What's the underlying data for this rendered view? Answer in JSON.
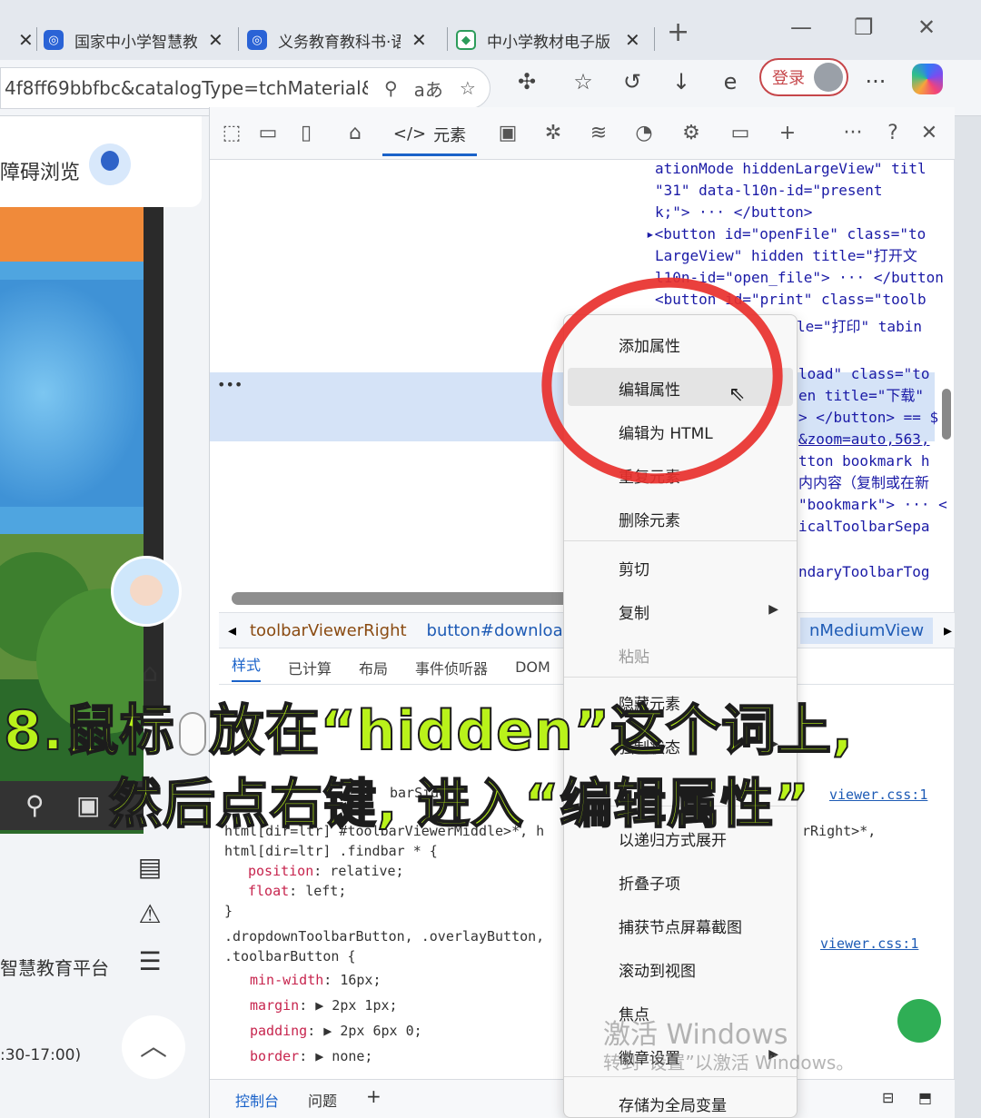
{
  "tabs": [
    {
      "title": "国家中小学智慧教",
      "close": "✕"
    },
    {
      "title": "义务教育教科书·语",
      "close": "✕"
    },
    {
      "title": "中小学教材电子版",
      "close": "✕"
    }
  ],
  "first_tab_close": "✕",
  "new_tab": "+",
  "address": {
    "url": "4f8ff69bbfbc&catalogType=tchMaterial&..."
  },
  "login_label": "登录",
  "page": {
    "accessibility_label": "障碍浏览",
    "platform_label": "智慧教育平台",
    "time_label": ":30-17:00)"
  },
  "devtools": {
    "elements_tab": "元素",
    "code_lines": [
      "ationMode hiddenLargeView\" titl",
      "\"31\" data-l10n-id=\"present",
      "k;\"> ··· </button>",
      "▸<button id=\"openFile\" class=\"to",
      "LargeView\" hidden title=\"打开文",
      "l10n-id=\"open_file\"> ··· </button",
      "<button id=\"print\" class=\"toolb",
      "le=\"打印\" tabin"
    ],
    "right_lines": [
      "load\" class=\"to",
      "en title=\"下载\"",
      "> </button> == $",
      "&zoom=auto,563,",
      "tton bookmark h",
      "内内容（复制或在新",
      "\"bookmark\"> ··· <",
      "icalToolbarSepa",
      "ndaryToolbarTog"
    ],
    "ellipsis": "•••",
    "breadcrumbs": {
      "c1": "toolbarViewerRight",
      "c2": "button#download.t",
      "c3": "nMediumView"
    },
    "subtabs": [
      "样式",
      "已计算",
      "布局",
      "事件侦听器",
      "DOM"
    ],
    "css_lines": [
      "html[dir=ltr] #toolbarViewerMiddle>*, h",
      "html[dir=ltr] .findbar * {",
      "position: relative;",
      "float: left;",
      "}",
      ".dropdownToolbarButton, .overlayButton,",
      ".toolbarButton {",
      "min-width: 16px;",
      "margin: ▶ 2px 1px;",
      "padding: ▶ 2px 6px 0;",
      "border: ▶ none;"
    ],
    "css_partials": {
      "sidebar": "barSide",
      "rightpart": "rRight>*,",
      "viewer1": "viewer.css:1",
      "viewer2": "viewer.css:1"
    },
    "bottom_tabs": {
      "console": "控制台",
      "issues": "问题",
      "add": "+"
    }
  },
  "context_menu": {
    "items": [
      {
        "label": "添加属性",
        "disabled": false
      },
      {
        "label": "编辑属性",
        "disabled": false,
        "highlighted": true
      },
      {
        "label": "编辑为 HTML",
        "disabled": false
      },
      {
        "label": "重复元素",
        "disabled": false
      },
      {
        "label": "删除元素",
        "disabled": false
      },
      {
        "label": "剪切",
        "disabled": false
      },
      {
        "label": "复制",
        "disabled": false,
        "submenu": true
      },
      {
        "label": "粘贴",
        "disabled": true
      },
      {
        "label": "隐藏元素",
        "disabled": false
      },
      {
        "label": "强制状态",
        "disabled": false,
        "submenu": true
      },
      {
        "label": "以递归方式展开",
        "disabled": false
      },
      {
        "label": "折叠子项",
        "disabled": false
      },
      {
        "label": "捕获节点屏幕截图",
        "disabled": false
      },
      {
        "label": "滚动到视图",
        "disabled": false
      },
      {
        "label": "焦点",
        "disabled": false
      },
      {
        "label": "徽章设置",
        "disabled": false,
        "submenu": true
      },
      {
        "label": "存储为全局变量",
        "disabled": false
      }
    ]
  },
  "annotation": {
    "line1_prefix": "8.鼠标",
    "line1_suffix": "放在“hidden”这个词上,",
    "line2": "然后点右键, 进入“编辑属性”"
  },
  "watermark": {
    "line1": "激活 Windows",
    "line2": "转到“设置”以激活 Windows。"
  },
  "colors": {
    "accent": "#1a62c9",
    "annotation_text": "#b9f21a",
    "circle": "#e8302c",
    "login": "#c6464a"
  }
}
